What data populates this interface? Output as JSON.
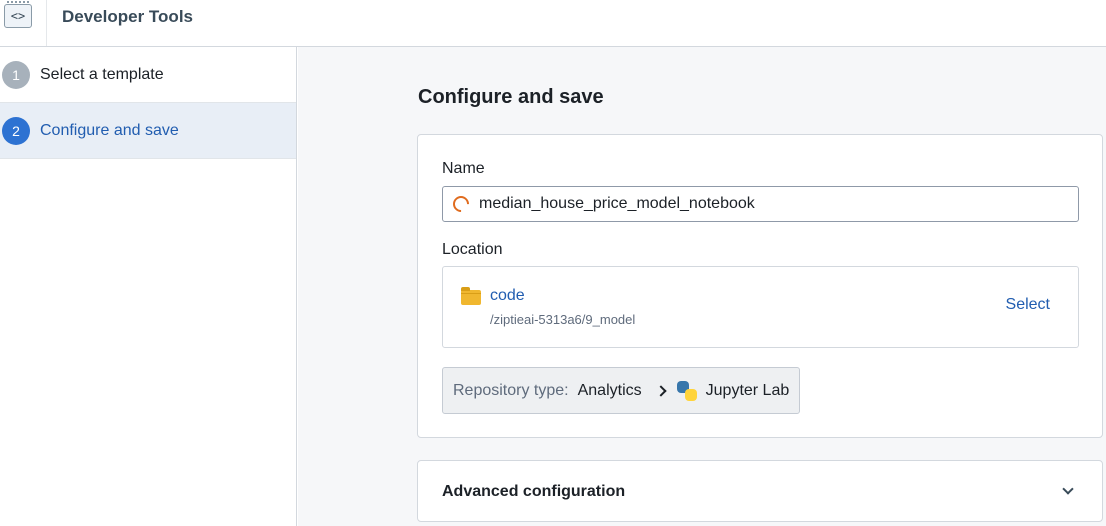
{
  "app": {
    "title": "Developer Tools",
    "icon": "code-brackets-icon",
    "icon_glyph": "<>"
  },
  "sidebar": {
    "steps": [
      {
        "number": "1",
        "label": "Select a template",
        "active": false
      },
      {
        "number": "2",
        "label": "Configure and save",
        "active": true
      }
    ]
  },
  "main": {
    "title": "Configure and save",
    "name_field": {
      "label": "Name",
      "value": "median_house_price_model_notebook",
      "icon": "loading-spinner-icon"
    },
    "location": {
      "label": "Location",
      "folder_name": "code",
      "folder_path": "/ziptieai-5313a6/9_model",
      "select_label": "Select",
      "icon": "folder-icon"
    },
    "repository": {
      "label": "Repository type:",
      "type": "Analytics",
      "app": "Jupyter Lab",
      "icon": "python-icon"
    },
    "advanced": {
      "title": "Advanced configuration",
      "expanded": false
    }
  },
  "colors": {
    "accent": "#2d72d2",
    "link": "#215db0",
    "active_step_bg": "#e8eef6",
    "folder": "#f0b72f",
    "spinner": "#e06c1f"
  }
}
